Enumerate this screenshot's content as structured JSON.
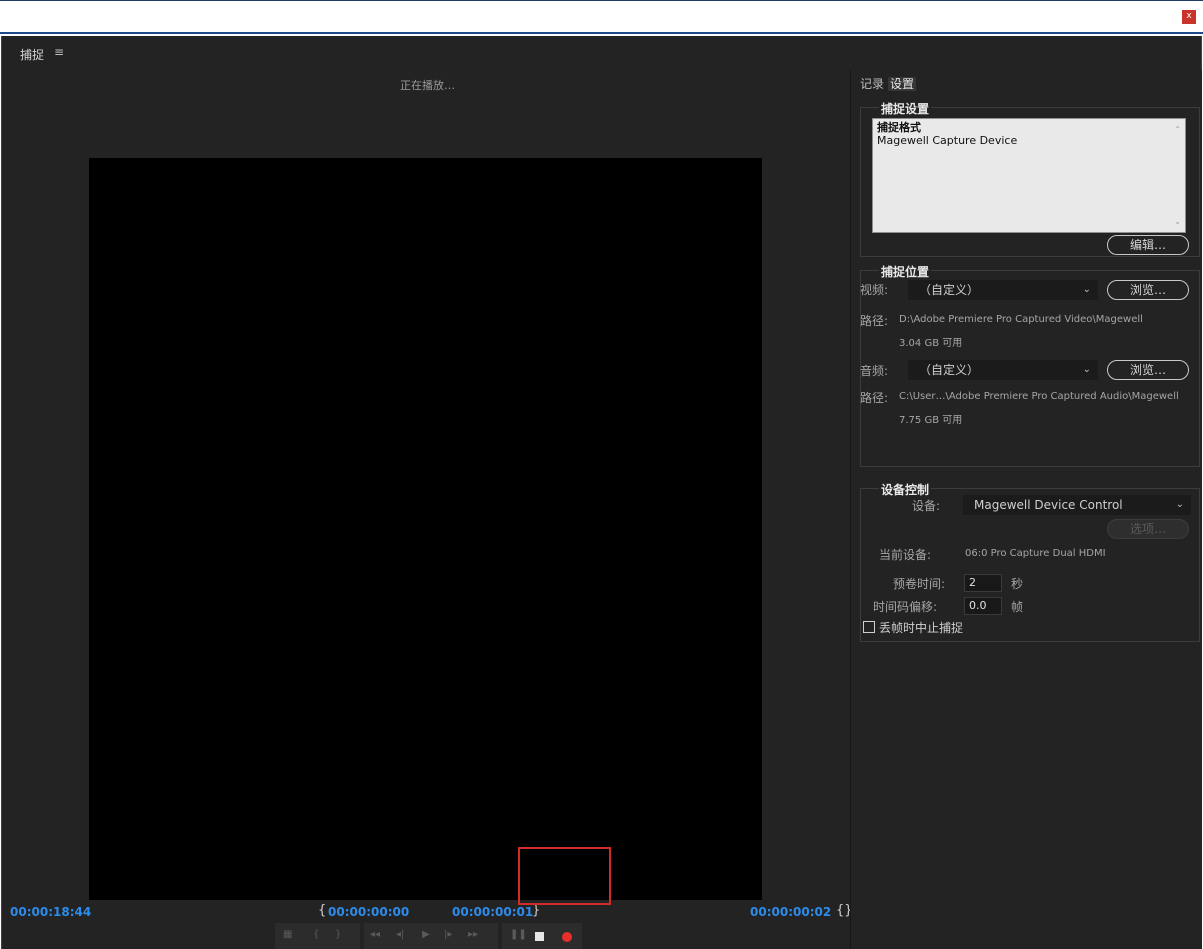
{
  "window": {
    "close_label": "x"
  },
  "panel": {
    "title": "捕捉",
    "menu_icon": "≡"
  },
  "monitor": {
    "status": "正在播放…",
    "timecode_current": "00:00:18:44",
    "timecode_in": "00:00:00:00",
    "timecode_out": "00:00:00:01",
    "timecode_duration": "00:00:00:02"
  },
  "side": {
    "tabs": {
      "log": "记录",
      "settings": "设置"
    },
    "capture_settings": {
      "title": "捕捉设置",
      "format_header": "捕捉格式",
      "format_value": "Magewell Capture Device",
      "edit_button": "编辑…"
    },
    "capture_locations": {
      "title": "捕捉位置",
      "video_label": "视频:",
      "video_value": "（自定义）",
      "browse_video": "浏览…",
      "video_path_label": "路径:",
      "video_path": "D:\\Adobe Premiere Pro Captured Video\\Magewell",
      "video_free": "3.04 GB 可用",
      "audio_label": "音频:",
      "audio_value": "（自定义）",
      "browse_audio": "浏览…",
      "audio_path_label": "路径:",
      "audio_path": "C:\\User…\\Adobe Premiere Pro Captured Audio\\Magewell",
      "audio_free": "7.75 GB 可用"
    },
    "device_control": {
      "title": "设备控制",
      "device_label": "设备:",
      "device_value": "Magewell Device Control",
      "options_button": "选项…",
      "current_device_label": "当前设备:",
      "current_device_value": "06:0 Pro Capture Dual HDMI",
      "preroll_label": "预卷时间:",
      "preroll_value": "2",
      "preroll_unit": "秒",
      "offset_label": "时间码偏移:",
      "offset_value": "0.0",
      "offset_unit": "帧",
      "abort_label": "丢帧时中止捕捉"
    }
  },
  "colors": {
    "timecode": "#2d8ceb",
    "record": "#e8302a",
    "highlight": "#d32a2a",
    "panel_bg": "#232323"
  }
}
